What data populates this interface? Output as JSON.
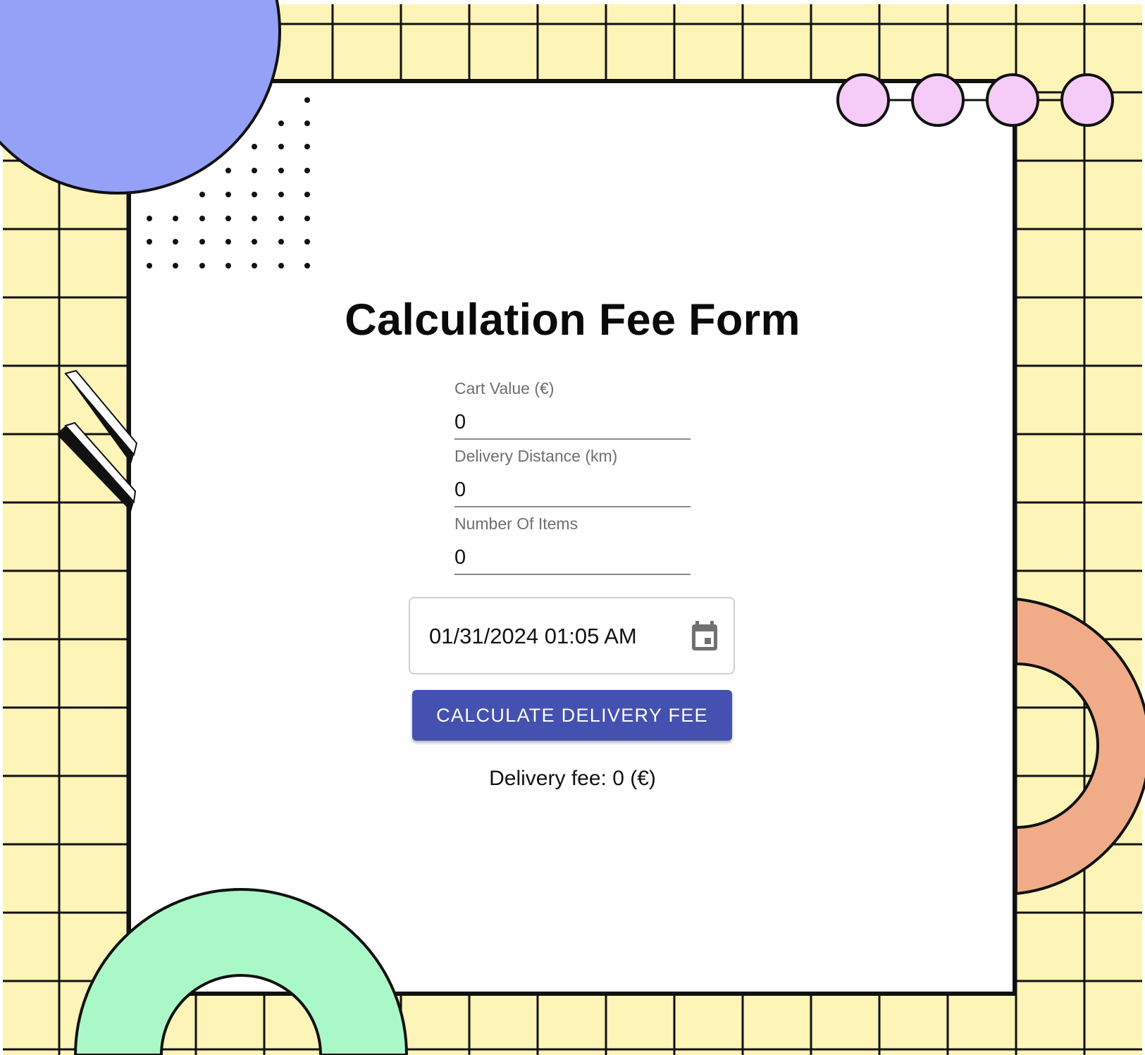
{
  "form": {
    "title": "Calculation Fee Form",
    "cart_value": {
      "label": "Cart Value (€)",
      "value": "0"
    },
    "delivery_distance": {
      "label": "Delivery Distance (km)",
      "value": "0"
    },
    "number_of_items": {
      "label": "Number Of Items",
      "value": "0"
    },
    "delivery_time": {
      "value": "01/31/2024 01:05 AM",
      "icon": "calendar-icon"
    },
    "calculate_button": {
      "label": "CALCULATE DELIVERY FEE"
    },
    "result": {
      "text": "Delivery fee: 0 (€)"
    }
  },
  "colors": {
    "grid_background": "#fdf4b7",
    "grid_lines": "#111111",
    "blue_circle": "#95a1f7",
    "pink_circles": "#f4ccf7",
    "orange_ring": "#f0ac88",
    "green_ring": "#aaf8c8",
    "button": "#4551b0"
  }
}
